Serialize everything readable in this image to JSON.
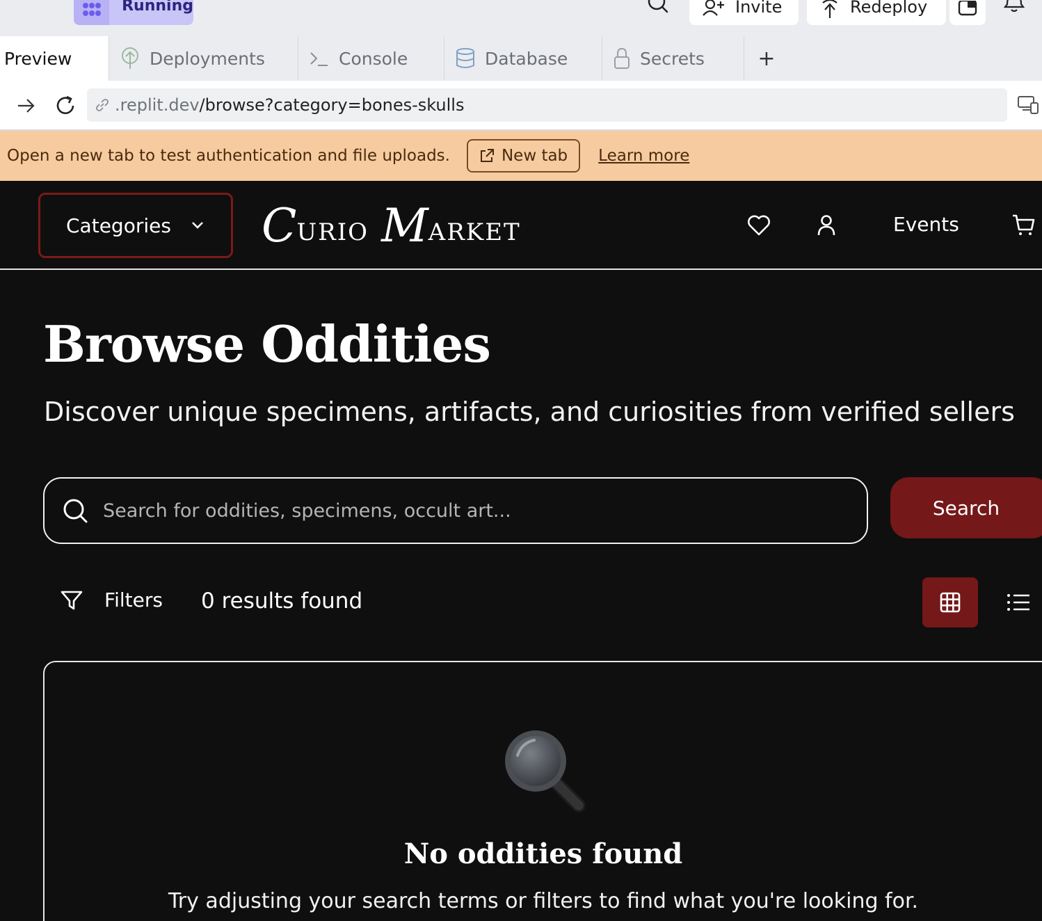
{
  "workspace": {
    "status": "Running",
    "invite_label": "Invite",
    "redeploy_label": "Redeploy"
  },
  "tabs": [
    {
      "label": "Preview",
      "icon": "none"
    },
    {
      "label": "Deployments",
      "icon": "deployments-icon"
    },
    {
      "label": "Console",
      "icon": "terminal-icon"
    },
    {
      "label": "Database",
      "icon": "database-icon"
    },
    {
      "label": "Secrets",
      "icon": "lock-icon"
    },
    {
      "label": "+",
      "icon": "plus-icon"
    }
  ],
  "address": {
    "host": ".replit.dev",
    "path": "/browse?category=bones-skulls"
  },
  "banner": {
    "message": "Open a new tab to test authentication and file uploads.",
    "new_tab_label": "New tab",
    "learn_more_label": "Learn more"
  },
  "site_nav": {
    "categories_label": "Categories",
    "brand_first_cap": "C",
    "brand_first_rest": "URIO",
    "brand_second_cap": "M",
    "brand_second_rest": "ARKET",
    "events_label": "Events"
  },
  "main": {
    "title": "Browse Oddities",
    "subtitle": "Discover unique specimens, artifacts, and curiosities from verified sellers",
    "search_placeholder": "Search for oddities, specimens, occult art...",
    "search_button": "Search",
    "filters_label": "Filters",
    "results_text": "0 results found",
    "empty_title": "No oddities found",
    "empty_text": "Try adjusting your search terms or filters to find what you're looking for."
  },
  "colors": {
    "accent": "#74181a",
    "banner_bg": "#f7cba0",
    "page_bg": "#0f0f0f"
  }
}
